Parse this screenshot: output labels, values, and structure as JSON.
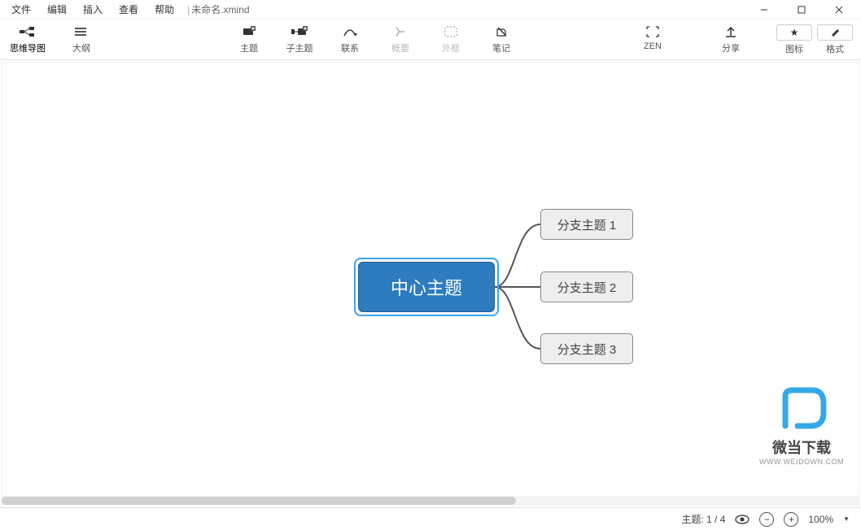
{
  "menu": {
    "items": [
      "文件",
      "编辑",
      "插入",
      "查看",
      "帮助"
    ],
    "doc_title": "未命名.xmind"
  },
  "toolbar": {
    "left": [
      {
        "id": "mindmap",
        "label": "思维导图",
        "active": true
      },
      {
        "id": "outline",
        "label": "大纲"
      }
    ],
    "mid": [
      {
        "id": "topic",
        "label": "主题"
      },
      {
        "id": "subtopic",
        "label": "子主题"
      },
      {
        "id": "relationship",
        "label": "联系"
      },
      {
        "id": "summary",
        "label": "概要",
        "disabled": true
      },
      {
        "id": "boundary",
        "label": "外框",
        "disabled": true
      },
      {
        "id": "notes",
        "label": "笔记"
      }
    ],
    "right_group": [
      {
        "id": "zen",
        "label": "ZEN"
      },
      {
        "id": "share",
        "label": "分享"
      }
    ],
    "pills": [
      {
        "id": "icons",
        "label": "图标",
        "glyph": "star"
      },
      {
        "id": "format",
        "label": "格式",
        "glyph": "brush"
      }
    ]
  },
  "mindmap": {
    "central": "中心主题",
    "branches": [
      "分支主题 1",
      "分支主题 2",
      "分支主题 3"
    ]
  },
  "watermark": {
    "brand": "微当下载",
    "url": "WWW.WEIDOWN.COM"
  },
  "status": {
    "topic_label": "主题:",
    "topic_index": "1 / 4",
    "zoom": "100%"
  },
  "colors": {
    "accent": "#2e7cc0",
    "selection": "#3aa3ff"
  }
}
